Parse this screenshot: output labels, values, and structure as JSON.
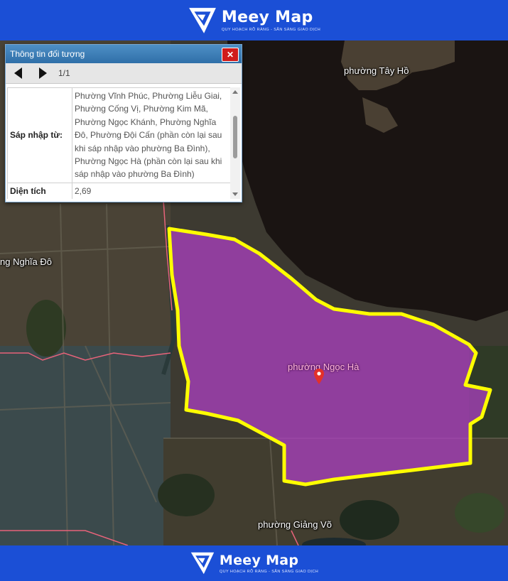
{
  "brand": {
    "name": "Meey Map",
    "tagline": "QUY HOẠCH RÕ RÀNG - SẴN SÀNG GIAO DỊCH"
  },
  "popup": {
    "title": "Thông tin đối tượng",
    "close_label": "✕",
    "page_indicator": "1/1",
    "rows": [
      {
        "key": "Sáp nhập từ:",
        "value": "Phường Vĩnh Phúc, Phường Liễu Giai, Phường Cống Vị, Phường Kim Mã, Phường Ngọc Khánh, Phường Nghĩa Đô, Phường Đội Cấn (phần còn lại sau khi sáp nhập vào phường Ba Đình), Phường Ngọc Hà (phần còn lại sau khi sáp nhập vào phường Ba Đình)"
      },
      {
        "key": "Diện tích",
        "value": "2,69"
      }
    ]
  },
  "map": {
    "labels": {
      "tay_ho": "phường Tây Hồ",
      "nghia_do": "ng Nghĩa Đô",
      "ngoc_ha": "phường Ngọc Hà",
      "giang_vo": "phường Giảng Võ"
    },
    "colors": {
      "selected_fill": "#b040c8",
      "selected_border": "#ffff00",
      "boundary_line": "#e8637a",
      "brand_blue": "#1b4fd6",
      "popup_header": "#3a7bb5",
      "close_button": "#d01c1c"
    }
  }
}
